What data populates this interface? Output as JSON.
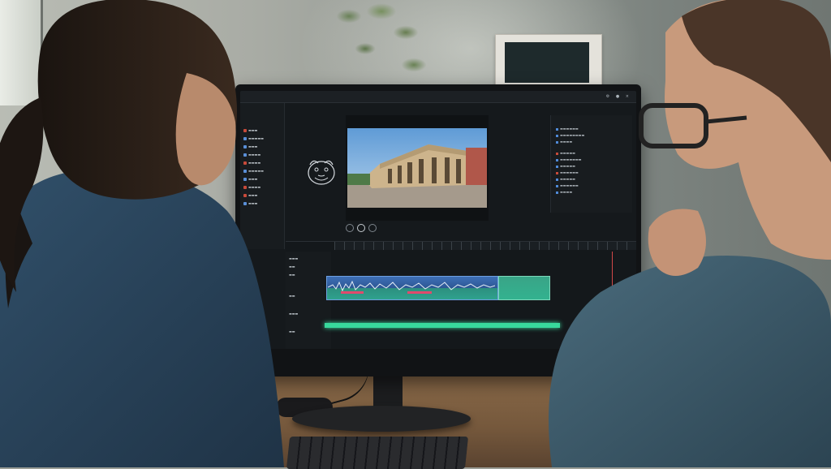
{
  "scene": "two people watching a video editing application on a monitor",
  "app": {
    "title": "",
    "source_viewer_label": "",
    "program_viewer_label": "",
    "inspector_title": "",
    "timecode": ""
  },
  "monitor": {
    "brand": ""
  },
  "colors": {
    "video_clip": "#3e6fb6",
    "audio_clip": "#2fa28d",
    "audio_track": "#38d89c",
    "marker": "#e24a6d",
    "playhead": "#d14848"
  },
  "icons": [
    "bulldog-logo-icon",
    "play-icon",
    "rewind-icon",
    "forward-icon",
    "gear-icon",
    "close-icon"
  ]
}
